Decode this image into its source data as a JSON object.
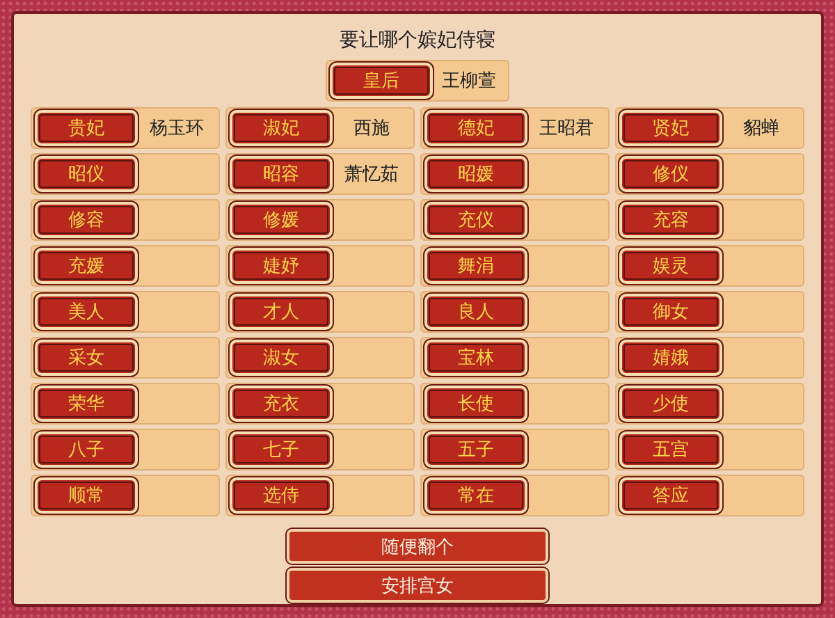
{
  "title": "要让哪个嫔妃侍寝",
  "empress": {
    "rank": "皇后",
    "name": "王柳萱"
  },
  "consorts": [
    {
      "rank": "贵妃",
      "name": "杨玉环"
    },
    {
      "rank": "淑妃",
      "name": "西施"
    },
    {
      "rank": "德妃",
      "name": "王昭君"
    },
    {
      "rank": "贤妃",
      "name": "貂蝉"
    },
    {
      "rank": "昭仪"
    },
    {
      "rank": "昭容",
      "name": "萧忆茹"
    },
    {
      "rank": "昭媛"
    },
    {
      "rank": "修仪"
    },
    {
      "rank": "修容"
    },
    {
      "rank": "修媛"
    },
    {
      "rank": "充仪"
    },
    {
      "rank": "充容"
    },
    {
      "rank": "充媛"
    },
    {
      "rank": "婕妤"
    },
    {
      "rank": "舞涓"
    },
    {
      "rank": "娱灵"
    },
    {
      "rank": "美人"
    },
    {
      "rank": "才人"
    },
    {
      "rank": "良人"
    },
    {
      "rank": "御女"
    },
    {
      "rank": "采女"
    },
    {
      "rank": "淑女"
    },
    {
      "rank": "宝林"
    },
    {
      "rank": "婧娥"
    },
    {
      "rank": "荣华"
    },
    {
      "rank": "充衣"
    },
    {
      "rank": "长使"
    },
    {
      "rank": "少使"
    },
    {
      "rank": "八子"
    },
    {
      "rank": "七子"
    },
    {
      "rank": "五子"
    },
    {
      "rank": "五宫"
    },
    {
      "rank": "顺常"
    },
    {
      "rank": "选侍"
    },
    {
      "rank": "常在"
    },
    {
      "rank": "答应"
    }
  ],
  "buttons": [
    "随便翻个",
    "安排宫女"
  ]
}
